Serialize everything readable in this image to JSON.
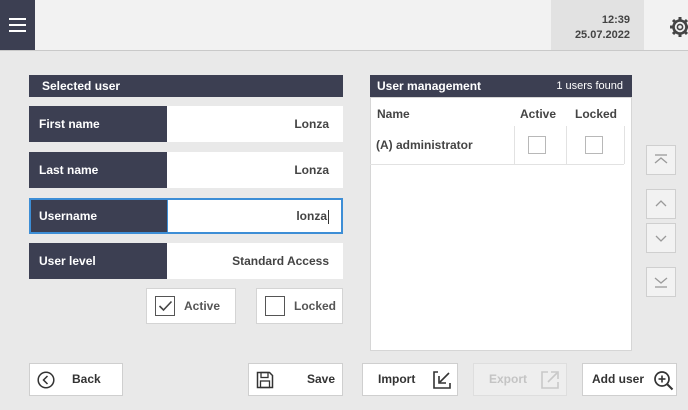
{
  "header": {
    "time": "12:39",
    "date": "25.07.2022"
  },
  "selected_user": {
    "title": "Selected user",
    "fields": [
      {
        "label": "First name",
        "value": "Lonza"
      },
      {
        "label": "Last name",
        "value": "Lonza"
      },
      {
        "label": "Username",
        "value": "lonza"
      },
      {
        "label": "User level",
        "value": "Standard Access"
      }
    ],
    "active_label": "Active",
    "active_checked": true,
    "locked_label": "Locked",
    "locked_checked": false
  },
  "user_management": {
    "title": "User management",
    "count_text": "1 users found",
    "columns": [
      "Name",
      "Active",
      "Locked"
    ],
    "rows": [
      {
        "name": "(A) administrator",
        "active": false,
        "locked": false
      }
    ]
  },
  "buttons": {
    "back": "Back",
    "save": "Save",
    "import": "Import",
    "export": "Export",
    "add_user": "Add user"
  },
  "icons": {
    "menu": "hamburger-icon",
    "settings": "gear-icon",
    "back": "circle-chevron-left-icon",
    "save": "floppy-disk-icon",
    "import": "arrow-in-box-icon",
    "export": "arrow-out-box-icon",
    "add_user": "zoom-plus-icon",
    "scroll": [
      "scroll-top-icon",
      "scroll-up-icon",
      "scroll-down-icon",
      "scroll-bottom-icon"
    ]
  },
  "colors": {
    "header_bg": "#3c3f52",
    "focus_border": "#3d8ed6",
    "background": "#e9e9e9"
  }
}
